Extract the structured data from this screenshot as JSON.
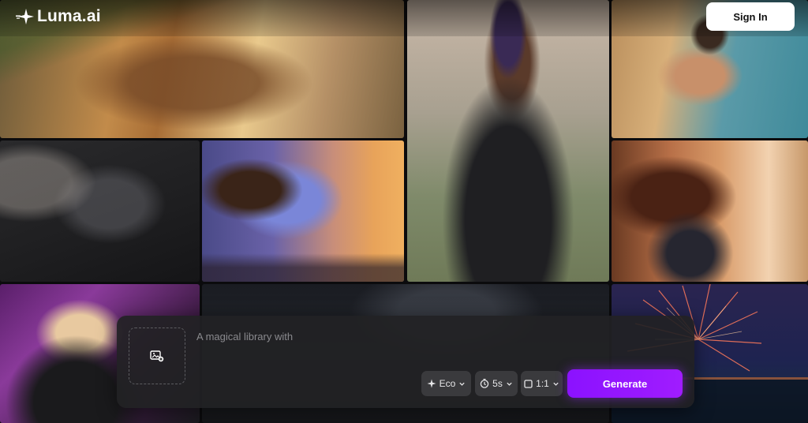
{
  "header": {
    "logo_text": "Luma.ai",
    "signin_label": "Sign In"
  },
  "gallery": {
    "tiles": [
      {
        "name": "gallery-tile-sweater-sunset"
      },
      {
        "name": "gallery-tile-laughing-woman"
      },
      {
        "name": "gallery-tile-pool-woman"
      },
      {
        "name": "gallery-tile-basketball-car"
      },
      {
        "name": "gallery-tile-smiling-woman-sunset"
      },
      {
        "name": "gallery-tile-lipstick-woman"
      },
      {
        "name": "gallery-tile-blonde-purple-light"
      },
      {
        "name": "gallery-tile-dark-scene"
      },
      {
        "name": "gallery-tile-fireworks"
      }
    ]
  },
  "prompt": {
    "placeholder": "A magical library with",
    "upload_icon": "image-add-icon",
    "quality_label": "Eco",
    "duration_label": "5s",
    "aspect_label": "1:1",
    "generate_label": "Generate"
  },
  "colors": {
    "accent": "#9b1cff",
    "panel": "#222224",
    "pill": "#3a3a3d"
  }
}
